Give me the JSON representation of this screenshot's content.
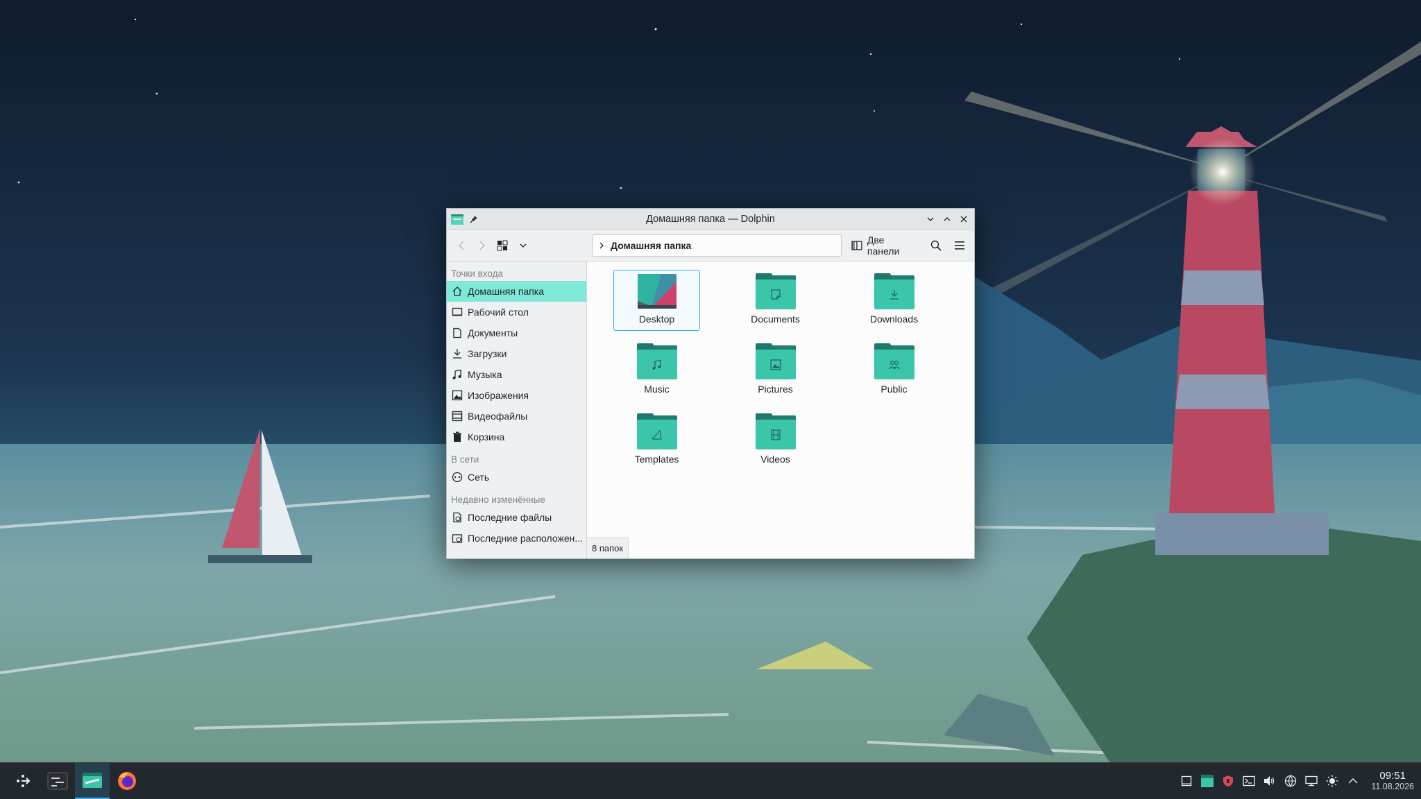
{
  "window": {
    "title": "Домашняя папка — Dolphin"
  },
  "toolbar": {
    "location_crumb": "Домашняя папка",
    "split_label": "Две панели"
  },
  "sidebar": {
    "sections": [
      {
        "title": "Точки входа",
        "items": [
          {
            "label": "Домашняя папка",
            "icon": "home-icon",
            "active": true
          },
          {
            "label": "Рабочий стол",
            "icon": "desktop-icon"
          },
          {
            "label": "Документы",
            "icon": "document-icon"
          },
          {
            "label": "Загрузки",
            "icon": "download-icon"
          },
          {
            "label": "Музыка",
            "icon": "music-icon"
          },
          {
            "label": "Изображения",
            "icon": "image-icon"
          },
          {
            "label": "Видеофайлы",
            "icon": "video-icon"
          },
          {
            "label": "Корзина",
            "icon": "trash-icon"
          }
        ]
      },
      {
        "title": "В сети",
        "items": [
          {
            "label": "Сеть",
            "icon": "network-icon"
          }
        ]
      },
      {
        "title": "Недавно изменённые",
        "items": [
          {
            "label": "Последние файлы",
            "icon": "recent-files-icon"
          },
          {
            "label": "Последние расположен...",
            "icon": "recent-locations-icon"
          }
        ]
      }
    ]
  },
  "files": [
    {
      "label": "Desktop",
      "icon": "desktop-folder-icon",
      "selected": true
    },
    {
      "label": "Documents",
      "icon": "documents-folder-icon"
    },
    {
      "label": "Downloads",
      "icon": "downloads-folder-icon"
    },
    {
      "label": "Music",
      "icon": "music-folder-icon"
    },
    {
      "label": "Pictures",
      "icon": "pictures-folder-icon"
    },
    {
      "label": "Public",
      "icon": "public-folder-icon"
    },
    {
      "label": "Templates",
      "icon": "templates-folder-icon"
    },
    {
      "label": "Videos",
      "icon": "videos-folder-icon"
    }
  ],
  "status": {
    "text": "8 папок"
  },
  "taskbar": {
    "tasks": [
      "app-launcher-icon",
      "system-monitor-icon",
      "dolphin-icon",
      "firefox-icon"
    ],
    "tray": [
      "show-desktop-icon",
      "vault-icon",
      "security-shield-icon",
      "terminal-icon",
      "volume-icon",
      "network-tray-icon",
      "display-icon",
      "brightness-icon",
      "tray-expand-icon"
    ],
    "clock": {
      "time": "09:51",
      "date": "11.08.2026"
    }
  },
  "colors": {
    "accent": "#3daee9",
    "sidebar_active": "#7fe9d8",
    "folder": "#3bc6aa"
  }
}
